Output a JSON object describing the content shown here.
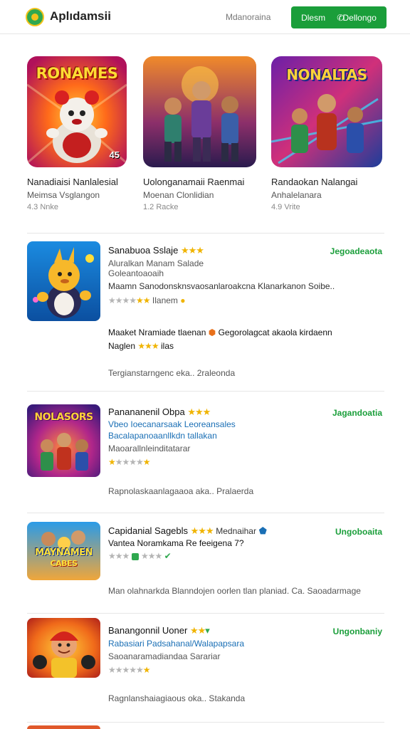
{
  "header": {
    "app_name": "Aplıdamsii",
    "link_label": "Mdanoraina",
    "button_left": "Dlesm",
    "button_right": "Dellongo"
  },
  "featured": [
    {
      "art_text": "RONAMES",
      "title": "Nanadiaisi Nanlalesial",
      "subtitle": "Meimsa Vsglangon",
      "meta": "4.3 Nnke",
      "badge": "45"
    },
    {
      "art_text": "",
      "title": "Uolonganamaii Raenmai",
      "subtitle": "Moenan Clonlidian",
      "meta": "1.2 Racke"
    },
    {
      "art_text": "NONALTAS",
      "title": "Randaokan Nalangai",
      "subtitle": "Anhalelanara",
      "meta": "4.9 Vrite"
    }
  ],
  "list": [
    {
      "title": "Sanabuoa Sslaje",
      "status": "Jegoadeaota",
      "line1": "Aluralkan Manam  Salade",
      "line2": "Goleantoaoaih",
      "line3": "Maamn Sanodonsknsvaosanlaroakcna Klanarkanon  Soibe..",
      "line4": "Ilanem",
      "line5": "Maaket  Nramiade  tlaenan",
      "line5b": "Gegorolagcat  akaola  kirdaenn",
      "line6": "Naglen",
      "line6b": "ilas",
      "footer": "Tergianstarngenc eka..  2raleonda"
    },
    {
      "title": "Panananenil Obpa",
      "status": "Jagandoatia",
      "line1": "Vbeo  Ioecanarsaak  Leoreansales",
      "line2": "Bacalapanoaanllkdn tallakan",
      "line3": "Maoarallnleinditatarar",
      "footer": "Rapnolaskaanlagaaoa aka..  Pralaerda",
      "art_text": "NOLASORS"
    },
    {
      "title": "Capidanial Sagebls",
      "title_extra": "Mednaihar",
      "status": "Ungoboaita",
      "line1": "Vantea  Noramkama  Re  feeigena  7?",
      "footer": "Man olahnarkda  Blanndojen oorlen  tlan planiad.  Ca.   Saoadarmage",
      "art_text": "MAYNAMEN",
      "art_sub": "CABES"
    },
    {
      "title": "Banangonnil Uoner",
      "status": "Ungonbaniy",
      "line1": "Rabasiari  Padsahanal/Walapapsara",
      "line2": "Saoanaramadiandaa Sarariar",
      "footer": "Ragnlanshaiagiaous oka..  Stakanda"
    }
  ],
  "colors": {
    "accent": "#1a9e3a",
    "star": "#f0b400",
    "link": "#1a6fb5"
  }
}
